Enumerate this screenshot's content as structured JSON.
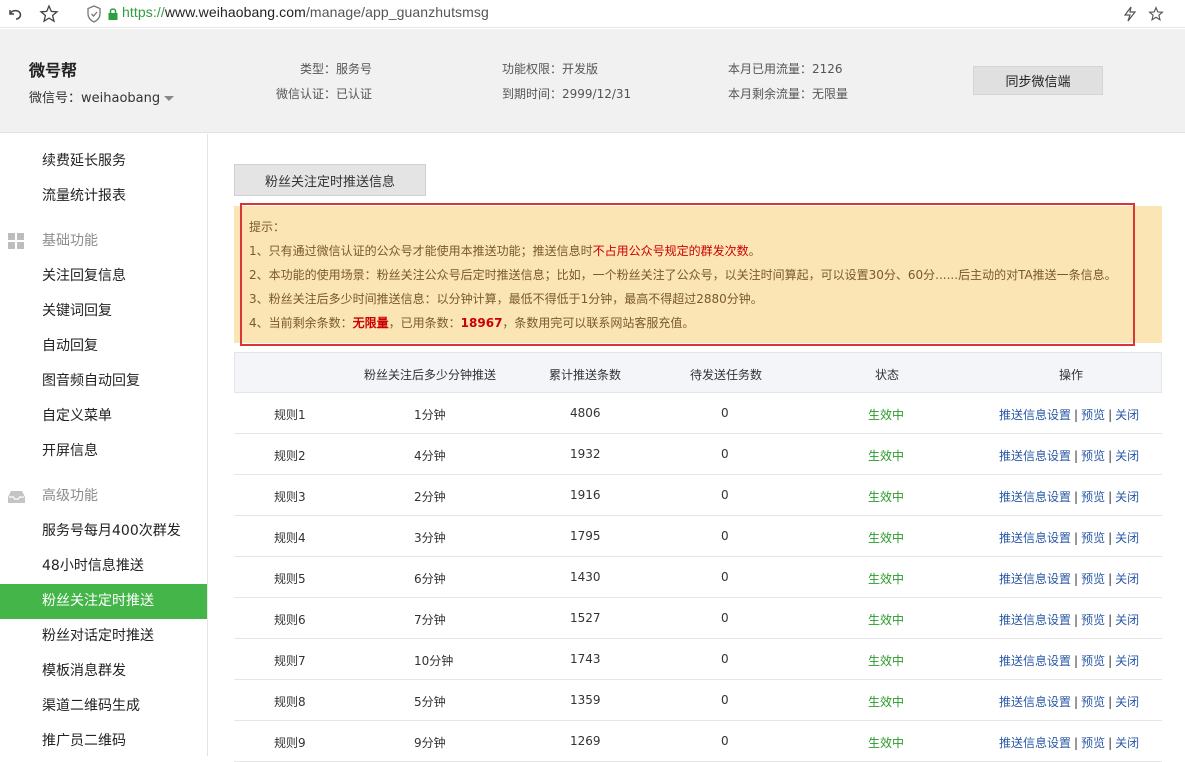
{
  "browser": {
    "url_proto": "https://",
    "url_host": "www.weihaobang.com",
    "url_path": "/manage/app_guanzhutsmsg"
  },
  "header": {
    "brand": "微号帮",
    "account": "微信号：weihaobang",
    "type": "类型：服务号",
    "verify": "微信认证：已认证",
    "permission": "功能权限：开发版",
    "expire": "到期时间：2999/12/31",
    "used_traffic": "本月已用流量：2126",
    "remain_traffic": "本月剩余流量：无限量",
    "sync_button": "同步微信端"
  },
  "sidebar": {
    "top_items": [
      "续费延长服务",
      "流量统计报表"
    ],
    "group_basic": "基础功能",
    "basic_items": [
      "关注回复信息",
      "关键词回复",
      "自动回复",
      "图音频自动回复",
      "自定义菜单",
      "开屏信息"
    ],
    "group_adv": "高级功能",
    "adv_items": [
      "服务号每月400次群发",
      "48小时信息推送",
      "粉丝关注定时推送",
      "粉丝对话定时推送",
      "模板消息群发",
      "渠道二维码生成",
      "推广员二维码"
    ],
    "active": "粉丝关注定时推送"
  },
  "main": {
    "tab": "粉丝关注定时推送信息",
    "tips": {
      "title": "提示：",
      "l1a": "1、只有通过微信认证的公众号才能使用本推送功能；推送信息时",
      "l1b": "不占用公众号规定的群发次数",
      "l1c": "。",
      "l2": "2、本功能的使用场景：粉丝关注公众号后定时推送信息；比如，一个粉丝关注了公众号，以关注时间算起，可以设置30分、60分......后主动的对TA推送一条信息。",
      "l3": "3、粉丝关注后多少时间推送信息：以分钟计算，最低不得低于1分钟，最高不得超过2880分钟。",
      "l4a": "4、当前剩余条数：",
      "l4b": "无限量",
      "l4c": "，已用条数：",
      "l4d": "18967",
      "l4e": "，条数用完可以联系网站客服充值。"
    },
    "table": {
      "headers": [
        "粉丝关注后多少分钟推送",
        "累计推送条数",
        "待发送任务数",
        "状态",
        "操作"
      ],
      "ops": [
        "推送信息设置",
        "预览",
        "关闭"
      ],
      "rows": [
        {
          "rule": "规则1",
          "minutes": "1分钟",
          "total": "4806",
          "pending": "0",
          "status": "生效中"
        },
        {
          "rule": "规则2",
          "minutes": "4分钟",
          "total": "1932",
          "pending": "0",
          "status": "生效中"
        },
        {
          "rule": "规则3",
          "minutes": "2分钟",
          "total": "1916",
          "pending": "0",
          "status": "生效中"
        },
        {
          "rule": "规则4",
          "minutes": "3分钟",
          "total": "1795",
          "pending": "0",
          "status": "生效中"
        },
        {
          "rule": "规则5",
          "minutes": "6分钟",
          "total": "1430",
          "pending": "0",
          "status": "生效中"
        },
        {
          "rule": "规则6",
          "minutes": "7分钟",
          "total": "1527",
          "pending": "0",
          "status": "生效中"
        },
        {
          "rule": "规则7",
          "minutes": "10分钟",
          "total": "1743",
          "pending": "0",
          "status": "生效中"
        },
        {
          "rule": "规则8",
          "minutes": "5分钟",
          "total": "1359",
          "pending": "0",
          "status": "生效中"
        },
        {
          "rule": "规则9",
          "minutes": "9分钟",
          "total": "1269",
          "pending": "0",
          "status": "生效中"
        }
      ]
    }
  },
  "colors": {
    "accent_green": "#44b549",
    "tip_bg": "#fbe5b4",
    "highlight_red": "#d9363a",
    "link_blue": "#2b5aa6",
    "status_green": "#2a9a2a"
  }
}
